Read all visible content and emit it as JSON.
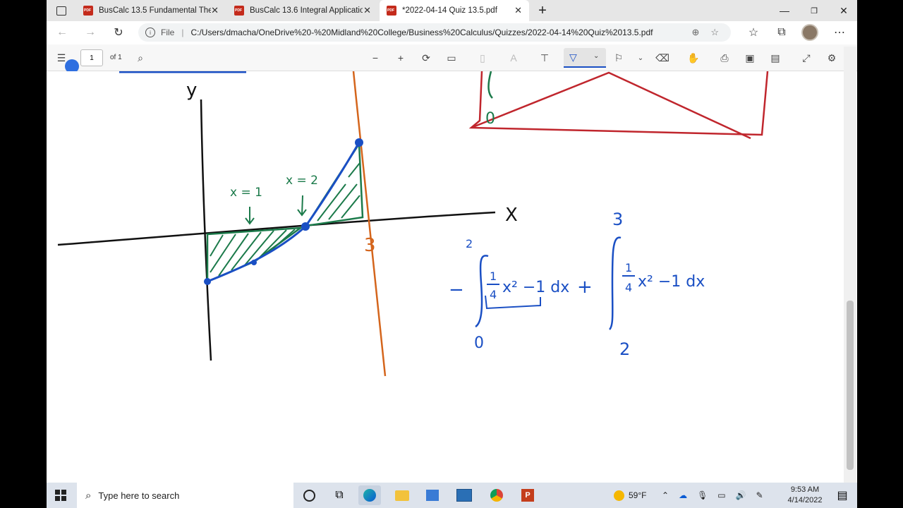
{
  "tabs": [
    {
      "title": "BusCalc 13.5 Fundamental Theor",
      "active": false
    },
    {
      "title": "BusCalc 13.6 Integral Applicatio",
      "active": false
    },
    {
      "title": "*2022-04-14 Quiz 13.5.pdf",
      "active": true
    }
  ],
  "address": {
    "scheme_label": "File",
    "url": "C:/Users/dmacha/OneDrive%20-%20Midland%20College/Business%20Calculus/Quizzes/2022-04-14%20Quiz%2013.5.pdf"
  },
  "pdf_toolbar": {
    "page_current": "1",
    "page_total": "of 1"
  },
  "drawing": {
    "axis_y_label": "y",
    "axis_x_label": "X",
    "label_x1": "x = 1",
    "label_x2": "x = 2",
    "label_three": "3",
    "integral1": {
      "upper": "2",
      "lower": "0",
      "sign": "−",
      "num": "1",
      "den": "4",
      "body": "x² −1 dx"
    },
    "plus": "+",
    "integral2": {
      "upper": "3",
      "lower": "2",
      "num": "1",
      "den": "4",
      "body": "x² −1 dx"
    },
    "box_digit": "0"
  },
  "taskbar": {
    "search_placeholder": "Type here to search",
    "weather": "59°F",
    "time": "9:53 AM",
    "date": "4/14/2022"
  },
  "colors": {
    "ink_black": "#111111",
    "ink_blue": "#1a4fc4",
    "ink_green": "#1b7a4a",
    "ink_orange": "#d4651c",
    "ink_red": "#c0262d",
    "accent": "#0a5bd3"
  }
}
